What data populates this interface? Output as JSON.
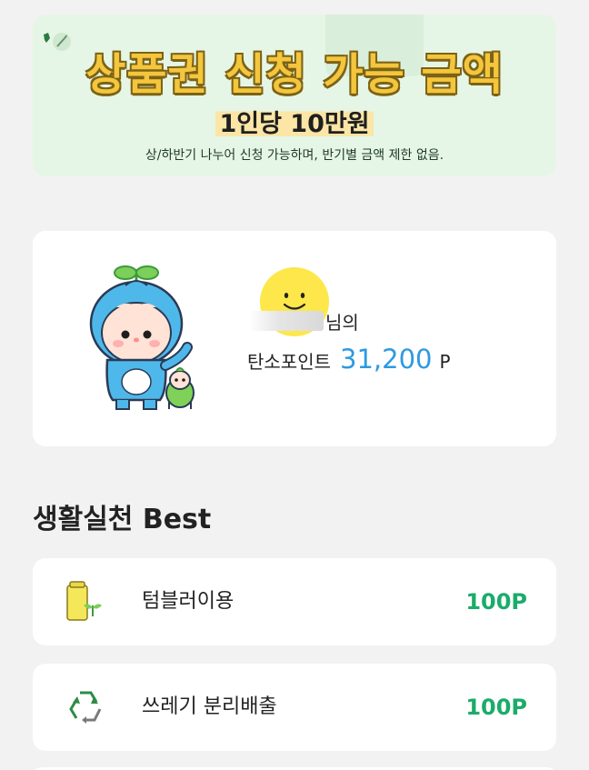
{
  "banner": {
    "title": "상품권 신청 가능 금액",
    "subtitle": "1인당 10만원",
    "note": "상/하반기 나누어 신청 가능하며, 반기별 금액 제한 없음."
  },
  "profile": {
    "name_suffix": "님의",
    "points_label": "탄소포인트",
    "points_value": "31,200",
    "points_unit": "P"
  },
  "best": {
    "title": "생활실천 Best",
    "items": [
      {
        "label": "텀블러이용",
        "points": "100P",
        "icon": "tumbler-icon"
      },
      {
        "label": "쓰레기 분리배출",
        "points": "100P",
        "icon": "recycle-icon"
      }
    ]
  },
  "colors": {
    "accent_green": "#1bab6b",
    "points_blue": "#2d9ae0",
    "banner_bg": "#e6f6e6",
    "title_yellow": "#f4c63d"
  }
}
